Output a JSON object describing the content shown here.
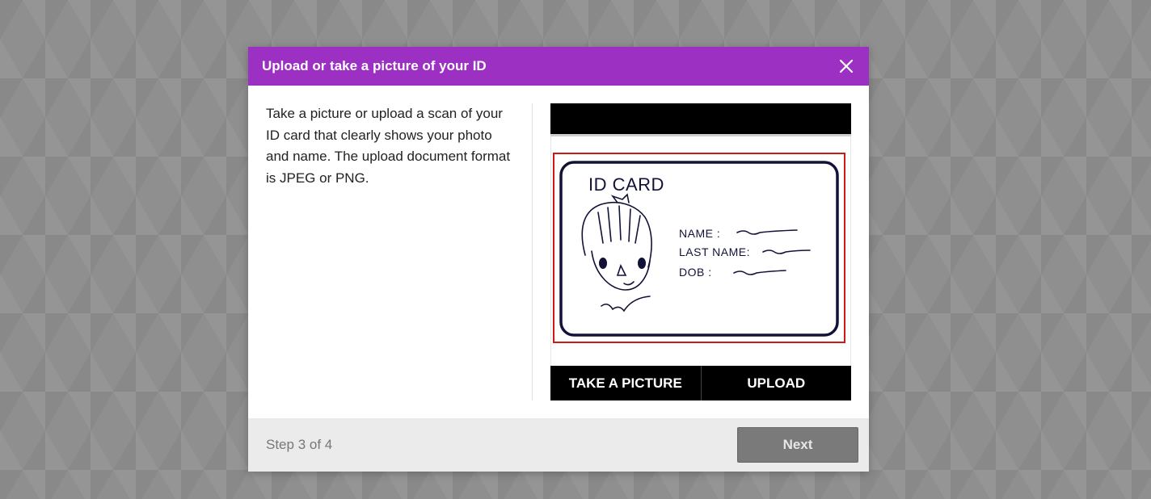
{
  "dialog": {
    "title": "Upload or take a picture of your ID",
    "close_icon": "close-icon",
    "instructions": "Take a picture or upload a scan of your ID card that clearly shows your photo and name. The upload document format is JPEG or PNG.",
    "accent_color": "#9b30c2"
  },
  "id_preview": {
    "card_title": "ID CARD",
    "fields": [
      "NAME :",
      "LAST NAME:",
      "DOB :"
    ],
    "frame_color": "#cc1a1a"
  },
  "actions": {
    "take_picture": "TAKE A PICTURE",
    "upload": "UPLOAD"
  },
  "footer": {
    "step": "Step 3 of 4",
    "next": "Next"
  }
}
